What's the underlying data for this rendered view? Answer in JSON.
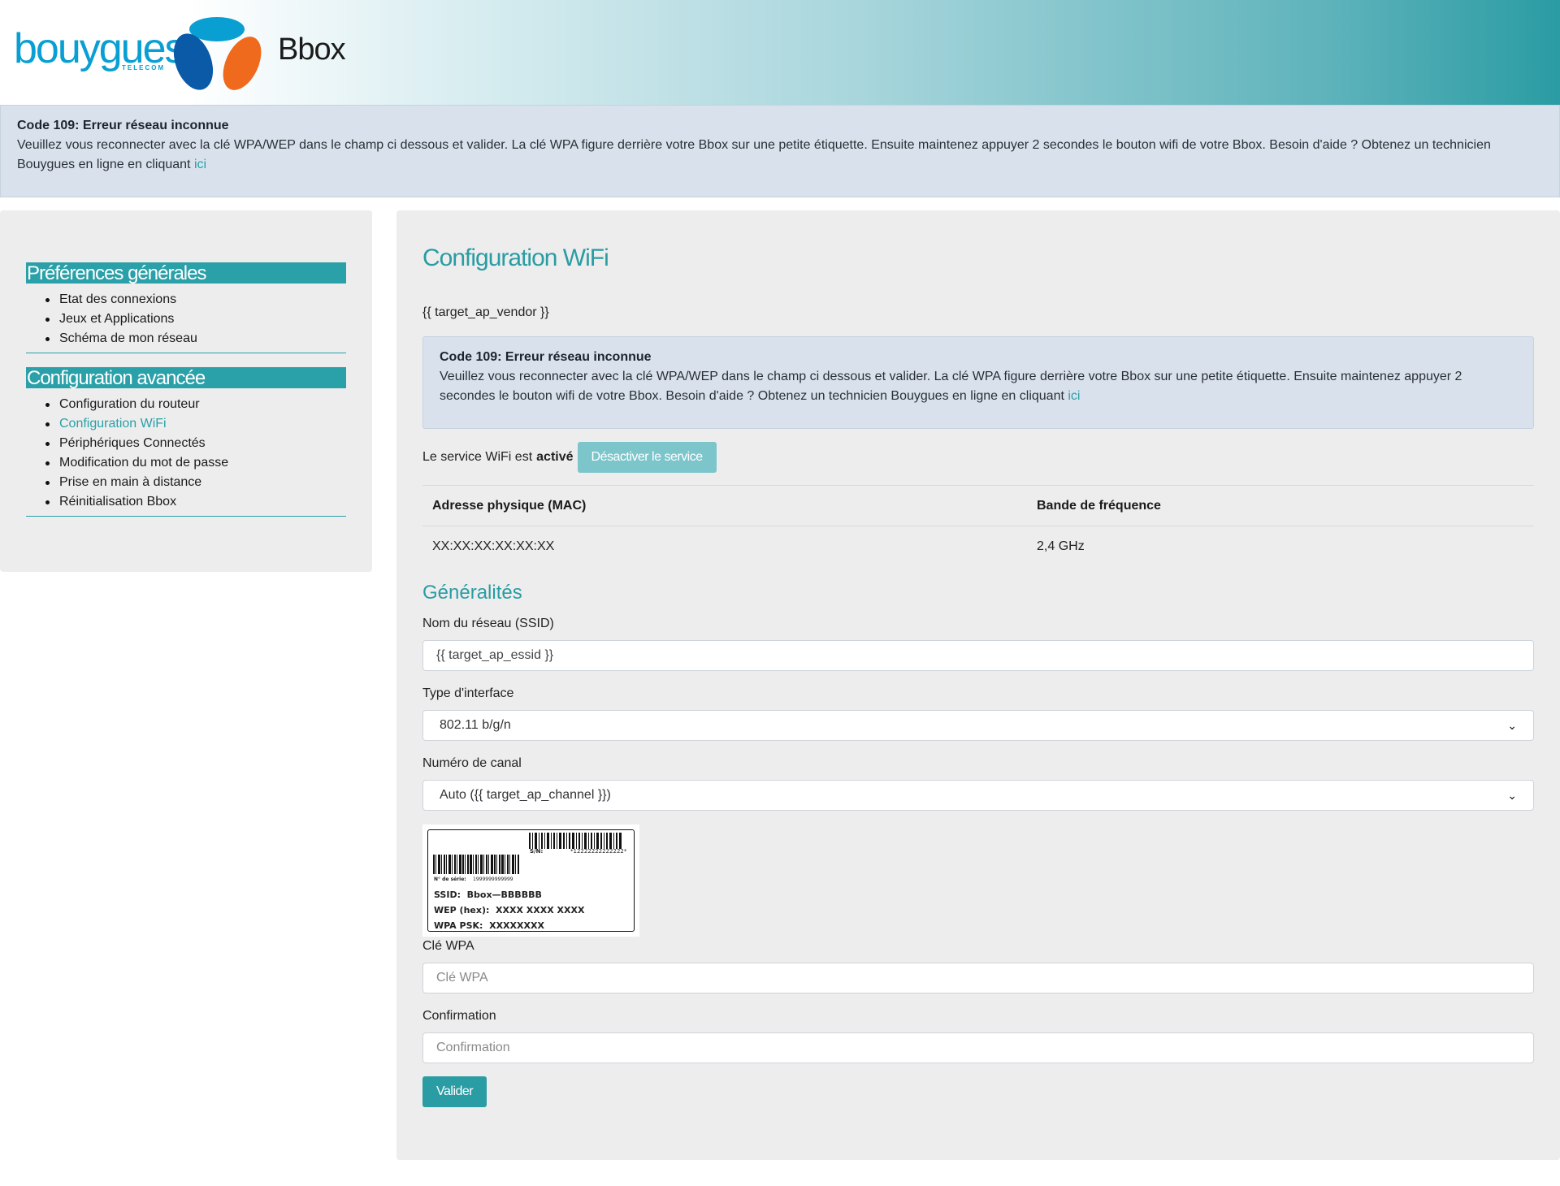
{
  "brand": {
    "logo_text": "bouygues",
    "logo_subtext": "TELECOM",
    "product": "Bbox",
    "colors": {
      "blue": "#0a9fd2",
      "dark_blue": "#0b5aa8",
      "orange": "#ef6a1c",
      "teal": "#2a9ca3"
    }
  },
  "alert": {
    "title": "Code 109: Erreur réseau inconnue",
    "message": "Veuillez vous reconnecter avec la clé WPA/WEP dans le champ ci dessous et valider. La clé WPA figure derrière votre Bbox sur une petite étiquette. Ensuite maintenez appuyer 2 secondes le bouton wifi de votre Bbox. Besoin d'aide ? Obtenez un technicien Bouygues en ligne en cliquant",
    "link_text": "ici"
  },
  "sidebar": {
    "sections": [
      {
        "title": "Préférences générales",
        "items": [
          "Etat des connexions",
          "Jeux et Applications",
          "Schéma de mon réseau"
        ]
      },
      {
        "title": "Configuration avancée",
        "items": [
          "Configuration du routeur",
          "Configuration WiFi",
          "Périphériques Connectés",
          "Modification du mot de passe",
          "Prise en main à distance",
          "Réinitialisation Bbox"
        ],
        "active_item": "Configuration WiFi"
      }
    ]
  },
  "main": {
    "title": "Configuration WiFi",
    "vendor": "{{ target_ap_vendor }}",
    "service": {
      "prefix": "Le service WiFi est",
      "state": "activé",
      "button": "Désactiver le service"
    },
    "table": {
      "headers": [
        "Adresse physique (MAC)",
        "Bande de fréquence"
      ],
      "row": [
        "XX:XX:XX:XX:XX:XX",
        "2,4 GHz"
      ]
    },
    "section_title": "Généralités",
    "fields": {
      "ssid_label": "Nom du réseau (SSID)",
      "ssid_value": "{{ target_ap_essid }}",
      "interface_label": "Type d'interface",
      "interface_value": "802.11 b/g/n",
      "channel_label": "Numéro de canal",
      "channel_value": "Auto ({{ target_ap_channel }})",
      "wpa_label": "Clé WPA",
      "wpa_placeholder": "Clé WPA",
      "confirm_label": "Confirmation",
      "confirm_placeholder": "Confirmation"
    },
    "sticker": {
      "sn_label": "S/N:",
      "sn_value": "*12222222222222*",
      "serial_label": "N° de série:",
      "serial_value": "1999999999999",
      "ssid_line": "SSID:  Bbox—BBBBBB",
      "wep_line": "WEP (hex):  XXXX XXXX XXXX",
      "wpa_line": "WPA PSK:  XXXXXXXX"
    },
    "submit": "Valider"
  }
}
